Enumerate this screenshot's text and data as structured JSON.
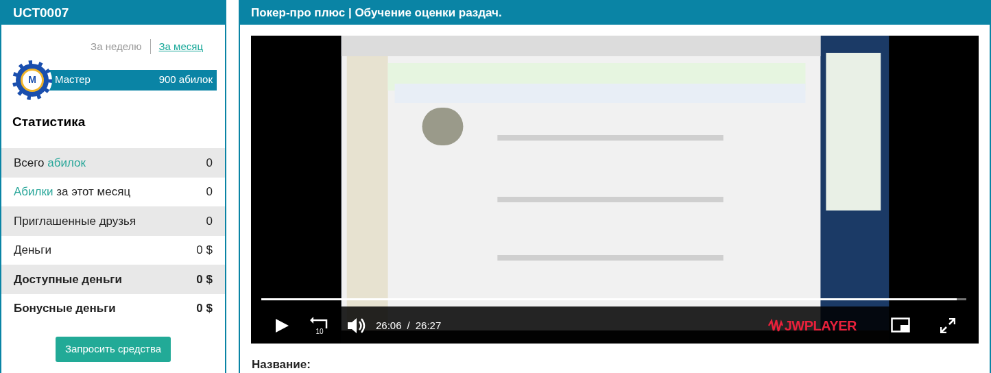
{
  "profile": {
    "title": "UCT0007",
    "periods": [
      {
        "label": "За неделю",
        "selected": false
      },
      {
        "label": "За месяц",
        "selected": true
      }
    ],
    "rank": {
      "badge": "M",
      "name": "Мастер",
      "points": "900 абилок"
    }
  },
  "stats": {
    "title": "Статистика",
    "rows": [
      {
        "parts": [
          {
            "text": "Всего ",
            "accent": false
          },
          {
            "text": "абилок",
            "accent": true
          }
        ],
        "value": "0",
        "bold": false,
        "shaded": true
      },
      {
        "parts": [
          {
            "text": "Абилки",
            "accent": true
          },
          {
            "text": " за этот месяц",
            "accent": false
          }
        ],
        "value": "0",
        "bold": false,
        "shaded": false
      },
      {
        "parts": [
          {
            "text": "Приглашенные друзья",
            "accent": false
          }
        ],
        "value": "0",
        "bold": false,
        "shaded": true
      },
      {
        "parts": [
          {
            "text": "Деньги",
            "accent": false
          }
        ],
        "value": "0 $",
        "bold": false,
        "shaded": false
      },
      {
        "parts": [
          {
            "text": "Доступные деньги",
            "accent": false
          }
        ],
        "value": "0 $",
        "bold": true,
        "shaded": true
      },
      {
        "parts": [
          {
            "text": "Бонусные деньги",
            "accent": false
          }
        ],
        "value": "0 $",
        "bold": true,
        "shaded": false
      }
    ],
    "button": "Запросить средства"
  },
  "course": {
    "title": "Покер-про плюс | Обучение оценки раздач.",
    "video": {
      "kind": "picture",
      "level": 0.986,
      "rewind_label": "10",
      "elapsed": "26:06",
      "separator": "/",
      "duration": "26:27",
      "logo": "JWPLAYER"
    },
    "field_label": "Название:"
  }
}
